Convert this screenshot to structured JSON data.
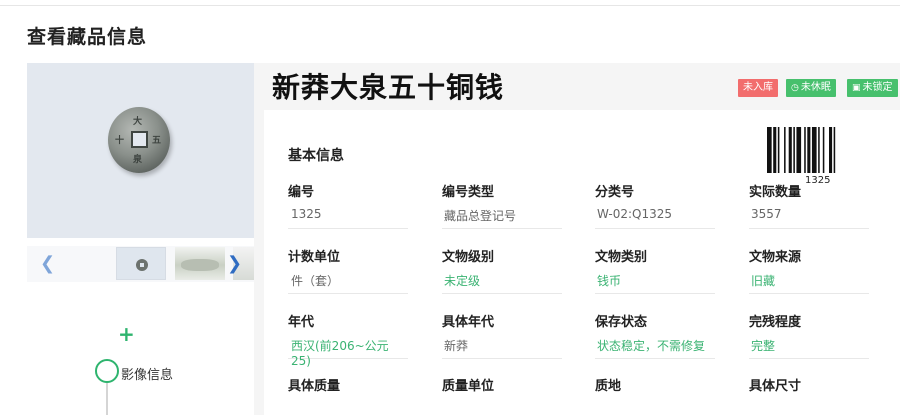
{
  "page": {
    "title": "查看藏品信息"
  },
  "object": {
    "title": "新莽大泉五十铜钱",
    "status_badges": [
      {
        "label": "未入库",
        "color": "#f26d6d"
      },
      {
        "label": "未休眠",
        "icon": "clock-icon",
        "color": "#47c06d"
      },
      {
        "label": "未锁定",
        "icon": "lock-icon",
        "color": "#47c06d"
      }
    ],
    "barcode_number": "1325"
  },
  "gallery": {
    "prev_icon": "chevron-left-icon",
    "next_icon": "chevron-right-icon",
    "coin_marks": [
      "大",
      "泉",
      "五",
      "十"
    ]
  },
  "timeline": {
    "add_icon": "plus-icon",
    "label": "影像信息"
  },
  "basic_info": {
    "title": "基本信息",
    "fields": [
      {
        "label": "编号",
        "value": "1325"
      },
      {
        "label": "编号类型",
        "value": "藏品总登记号"
      },
      {
        "label": "分类号",
        "value": "W-02:Q1325"
      },
      {
        "label": "实际数量",
        "value": "3557"
      },
      {
        "label": "计数单位",
        "value": "件（套）"
      },
      {
        "label": "文物级别",
        "value": "未定级"
      },
      {
        "label": "文物类别",
        "value": "钱币"
      },
      {
        "label": "文物来源",
        "value": "旧藏"
      },
      {
        "label": "年代",
        "value": "西汉(前206~公元25)"
      },
      {
        "label": "具体年代",
        "value": "新莽"
      },
      {
        "label": "保存状态",
        "value": "状态稳定，不需修复"
      },
      {
        "label": "完残程度",
        "value": "完整"
      },
      {
        "label": "具体质量",
        "value": ""
      },
      {
        "label": "质量单位",
        "value": ""
      },
      {
        "label": "质地",
        "value": ""
      },
      {
        "label": "具体尺寸",
        "value": ""
      }
    ]
  },
  "colors": {
    "accent_green": "#3bb373",
    "badge_red": "#f26d6d",
    "badge_green": "#47c06d"
  }
}
